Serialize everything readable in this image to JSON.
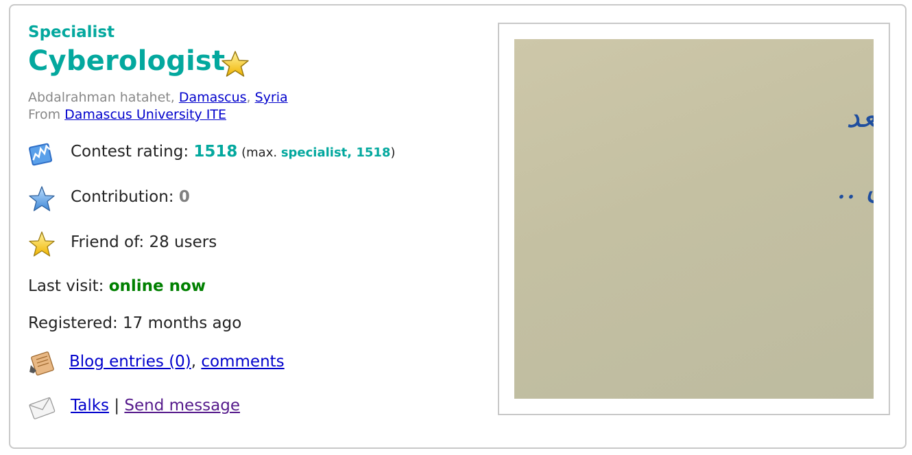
{
  "profile": {
    "rank": "Specialist",
    "handle": "Cyberologist",
    "name_prefix": "Abdalrahman hatahet, ",
    "city": "Damascus",
    "country": "Syria",
    "from_prefix": "From ",
    "organization": "Damascus University ITE"
  },
  "stats": {
    "rating_label": "Contest rating: ",
    "rating_value": "1518",
    "max_open": " (max. ",
    "max_rank_value": "specialist, 1518",
    "max_close": ")",
    "contribution_label": "Contribution: ",
    "contribution_value": "0",
    "friend_text": "Friend of: 28 users",
    "last_visit_label": "Last visit: ",
    "last_visit_value": "online now",
    "registered_text": "Registered: 17 months ago"
  },
  "links": {
    "blog_entries": "Blog entries (0)",
    "blog_sep": ", ",
    "comments": "comments",
    "talks": "Talks",
    "talks_sep": " | ",
    "send_message": "Send message"
  },
  "photo": {
    "line1": "لم تكن النهاية بعد",
    "line2": "لا تستسلم الآن .."
  },
  "colors": {
    "rank": "#03a89e",
    "online": "#008000",
    "link": "#0000cc",
    "visited_link": "#551a8b"
  },
  "icons": [
    "star-icon",
    "rating-chart-icon",
    "contribution-star-icon",
    "friend-star-icon",
    "blog-icon",
    "envelope-icon"
  ]
}
